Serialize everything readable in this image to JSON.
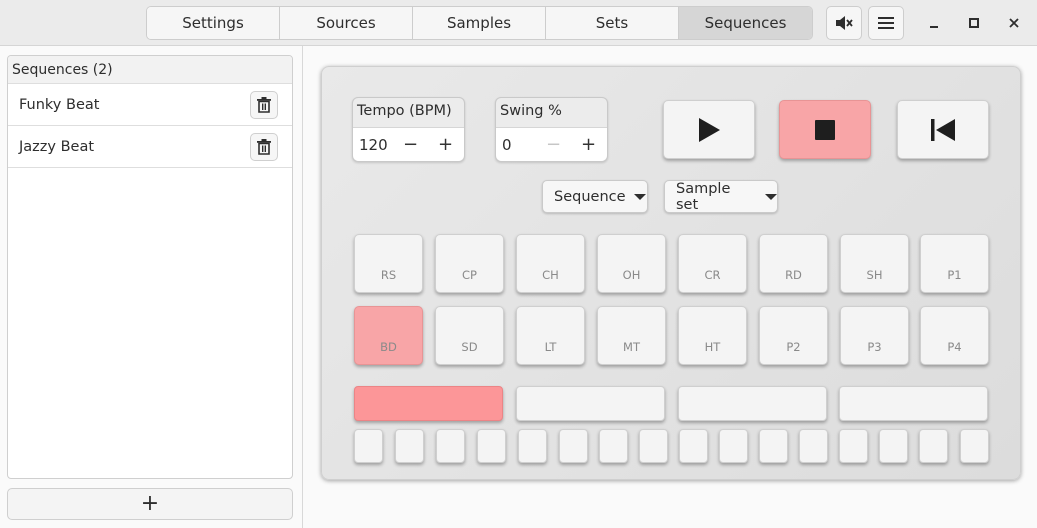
{
  "header": {
    "tabs": [
      {
        "label": "Settings",
        "active": false
      },
      {
        "label": "Sources",
        "active": false
      },
      {
        "label": "Samples",
        "active": false
      },
      {
        "label": "Sets",
        "active": false
      },
      {
        "label": "Sequences",
        "active": true
      }
    ],
    "icons": {
      "mute": "speaker-muted-icon",
      "menu": "hamburger-menu-icon",
      "minimize": "minimize-icon",
      "maximize": "maximize-icon",
      "close": "close-icon"
    }
  },
  "sidebar": {
    "title": "Sequences (2)",
    "items": [
      {
        "label": "Funky Beat",
        "action_icon": "trash-icon"
      },
      {
        "label": "Jazzy Beat",
        "action_icon": "trash-icon"
      }
    ],
    "add_symbol": "+"
  },
  "controls": {
    "tempo": {
      "label": "Tempo (BPM)",
      "value": "120",
      "minus": "−",
      "plus": "+"
    },
    "swing": {
      "label": "Swing %",
      "value": "0",
      "minus": "−",
      "plus": "+",
      "minus_disabled": true
    },
    "transport": {
      "play_icon": "play-icon",
      "stop_icon": "stop-icon",
      "rewind_icon": "skip-to-start-icon",
      "stop_active": true
    },
    "sequence_dropdown": "Sequence",
    "sample_set_dropdown": "Sample set"
  },
  "pads": [
    {
      "label": "RS",
      "active": false
    },
    {
      "label": "CP",
      "active": false
    },
    {
      "label": "CH",
      "active": false
    },
    {
      "label": "OH",
      "active": false
    },
    {
      "label": "CR",
      "active": false
    },
    {
      "label": "RD",
      "active": false
    },
    {
      "label": "SH",
      "active": false
    },
    {
      "label": "P1",
      "active": false
    },
    {
      "label": "BD",
      "active": true
    },
    {
      "label": "SD",
      "active": false
    },
    {
      "label": "LT",
      "active": false
    },
    {
      "label": "MT",
      "active": false
    },
    {
      "label": "HT",
      "active": false
    },
    {
      "label": "P2",
      "active": false
    },
    {
      "label": "P3",
      "active": false
    },
    {
      "label": "P4",
      "active": false
    }
  ],
  "bars": [
    true,
    false,
    false,
    false
  ],
  "steps": [
    false,
    false,
    false,
    false,
    false,
    false,
    false,
    false,
    false,
    false,
    false,
    false,
    false,
    false,
    false,
    false
  ],
  "colors": {
    "accent": "#f8a5a7",
    "bar_active": "#fc9698"
  }
}
